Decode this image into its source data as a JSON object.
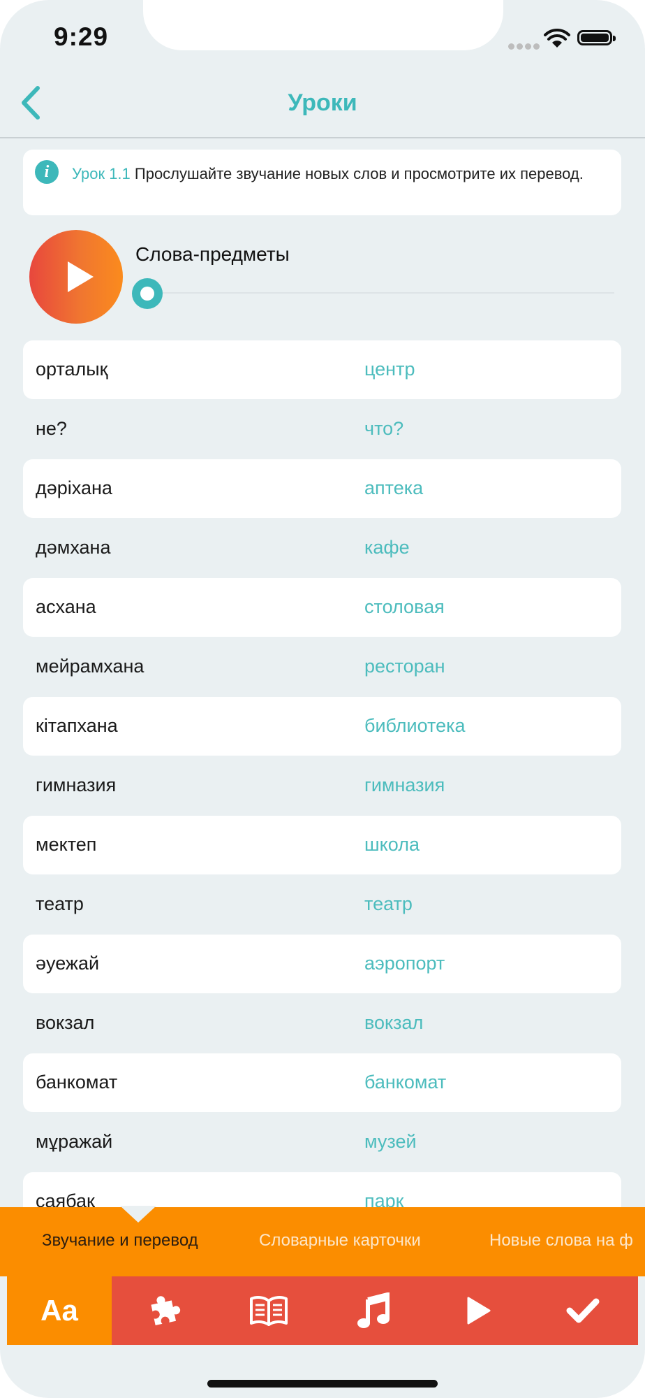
{
  "status_bar": {
    "time": "9:29"
  },
  "nav": {
    "title": "Уроки",
    "back_icon": "chevron-left-icon"
  },
  "info": {
    "lesson": "Урок 1.1",
    "text": " Прослушайте звучание новых слов и просмотрите их перевод."
  },
  "player": {
    "title": "Слова-предметы",
    "progress": 0
  },
  "words": [
    {
      "kz": "орталық",
      "ru": "центр"
    },
    {
      "kz": "не?",
      "ru": "что?"
    },
    {
      "kz": "дәріхана",
      "ru": "аптека"
    },
    {
      "kz": "дәмхана",
      "ru": "кафе"
    },
    {
      "kz": "асхана",
      "ru": "столовая"
    },
    {
      "kz": "мейрамхана",
      "ru": "ресторан"
    },
    {
      "kz": "кітапхана",
      "ru": "библиотека"
    },
    {
      "kz": "гимназия",
      "ru": "гимназия"
    },
    {
      "kz": "мектеп",
      "ru": "школа"
    },
    {
      "kz": "театр",
      "ru": "театр"
    },
    {
      "kz": "әуежай",
      "ru": "аэропорт"
    },
    {
      "kz": "вокзал",
      "ru": "вокзал"
    },
    {
      "kz": "банкомат",
      "ru": "банкомат"
    },
    {
      "kz": "мұражай",
      "ru": "музей"
    },
    {
      "kz": "саябақ",
      "ru": "парк"
    }
  ],
  "tabs": [
    {
      "label": "Звучание и перевод",
      "active": true
    },
    {
      "label": "Словарные карточки",
      "active": false
    },
    {
      "label": "Новые слова на ф",
      "active": false
    }
  ],
  "toolbar": {
    "items": [
      {
        "label": "Aa",
        "icon": "text-size-icon",
        "active": true
      },
      {
        "icon": "puzzle-icon"
      },
      {
        "icon": "book-icon"
      },
      {
        "icon": "music-note-icon"
      },
      {
        "icon": "play-icon"
      },
      {
        "icon": "check-icon"
      }
    ]
  },
  "colors": {
    "accent": "#3db8ba",
    "orange": "#fb8d00",
    "red": "#e64f3d",
    "background": "#eaf0f2"
  }
}
